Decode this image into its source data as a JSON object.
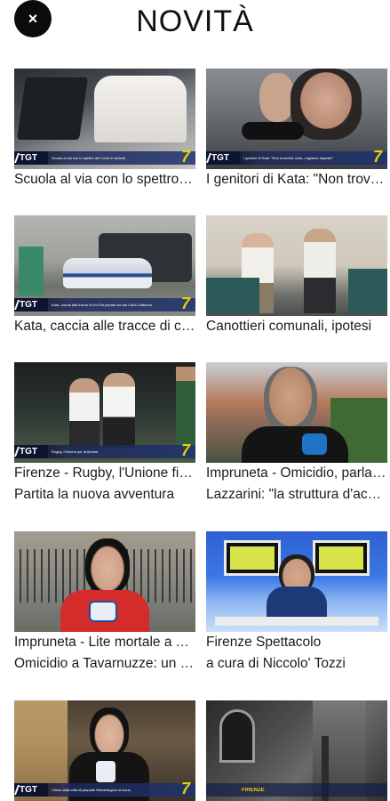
{
  "header": {
    "title": "NOVITÀ",
    "close_icon": "×"
  },
  "overlay": {
    "logo": "TGT",
    "channel": "7"
  },
  "items": [
    {
      "title": "Scuola al via con lo spettro del Covid",
      "subtitle": "",
      "ticker": "Scuola al via con lo spettro del Covid e varianti",
      "has_tgt": true
    },
    {
      "title": "I genitori di Kata: \"Non troverete",
      "subtitle": "",
      "ticker": "I genitori di Kata: \"Non troverete nulla, vogliamo risposte\"",
      "has_tgt": true
    },
    {
      "title": "Kata, caccia alle tracce di chi l'ha portata via",
      "subtitle": "",
      "ticker": "Kata, caccia alle tracce di chi l'ha portata via dal Carlo Cattaneo",
      "has_tgt": true
    },
    {
      "title": "Canottieri comunali, ipotesi",
      "subtitle": "",
      "ticker": "",
      "has_tgt": false
    },
    {
      "title": "Firenze - Rugby, l'Unione fiorentina",
      "subtitle": "Partita la nuova avventura",
      "ticker": "Rugby, l'Unione per la ripresa",
      "has_tgt": true
    },
    {
      "title": "Impruneta - Omicidio, parla il sindaco",
      "subtitle": "Lazzarini: \"la struttura d'accoglienza",
      "ticker": "",
      "has_tgt": false
    },
    {
      "title": "Impruneta - Lite mortale a Tavarnuzze",
      "subtitle": "Omicidio a Tavarnuzze: un morto",
      "ticker": "",
      "has_tgt": false
    },
    {
      "title": "Firenze Spettacolo",
      "subtitle": "a cura di Niccolo' Tozzi",
      "ticker": "",
      "has_tgt": false
    },
    {
      "title": "",
      "subtitle": "",
      "ticker": "Chiusi dalla città di piazzale Michelangelo la focus",
      "has_tgt": true
    },
    {
      "title": "",
      "subtitle": "",
      "ticker": "FIRENZE",
      "has_tgt": false
    }
  ]
}
